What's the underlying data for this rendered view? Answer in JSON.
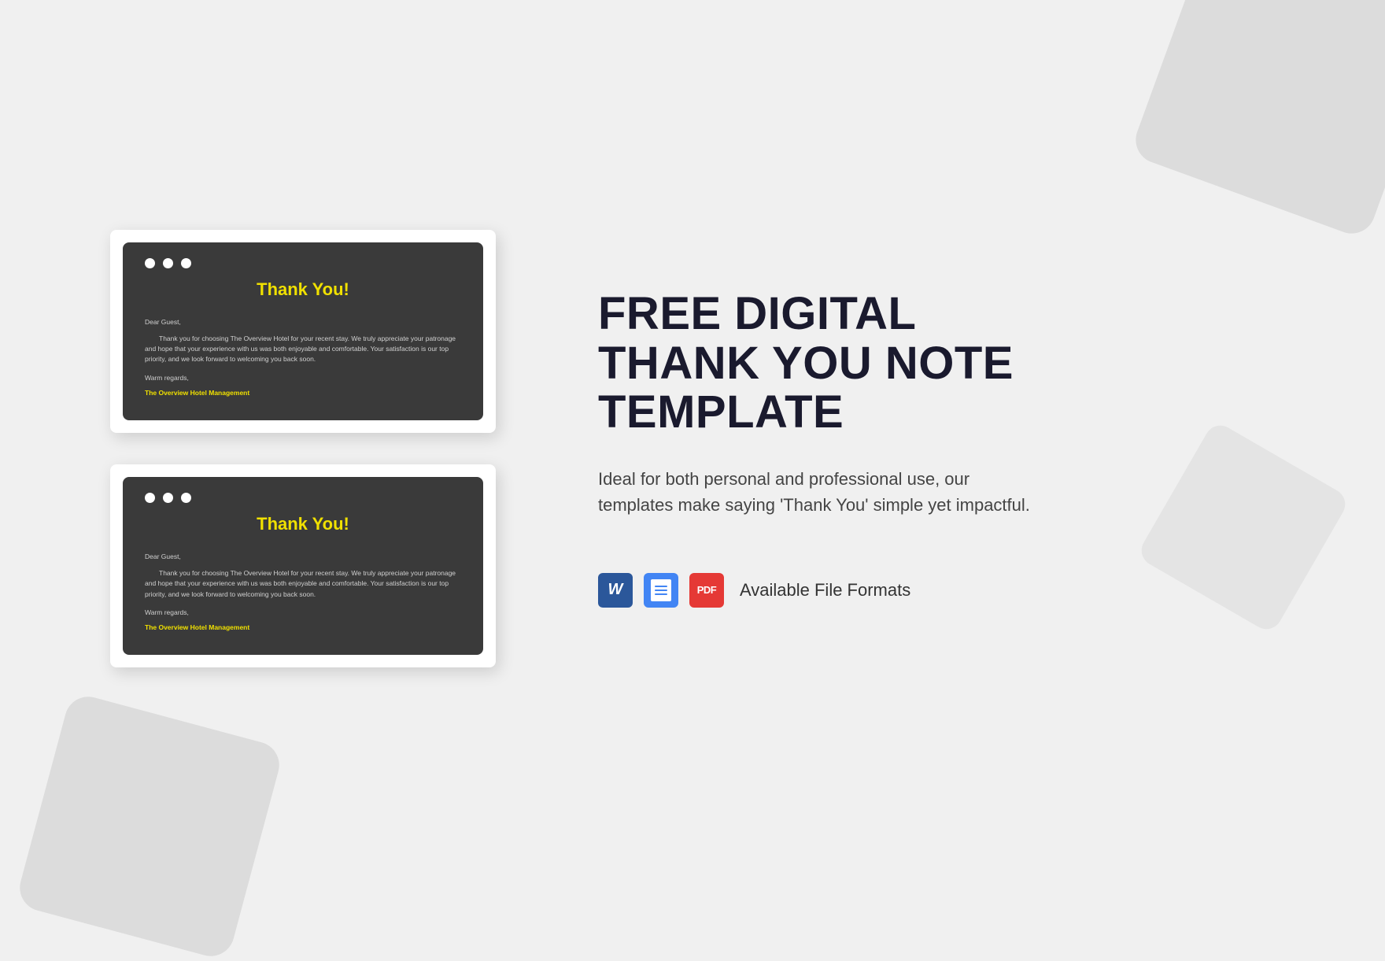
{
  "background": {
    "color": "#f0f0f0"
  },
  "card": {
    "dots": [
      "dot1",
      "dot2",
      "dot3"
    ],
    "title": "Thank You!",
    "title_color": "#f0e000",
    "greeting": "Dear Guest,",
    "body_text": "Thank you for choosing The Overview Hotel for your recent stay. We truly appreciate your patronage and hope that your experience with us was both enjoyable and comfortable. Your satisfaction is our top priority, and we look forward to welcoming you back soon.",
    "closing": "Warm regards,",
    "signature": "The Overview Hotel Management"
  },
  "right": {
    "main_title": "FREE DIGITAL\nTHANK YOU NOTE\nTEMPLATE",
    "description": "Ideal for both personal and professional use, our templates make saying 'Thank You' simple yet impactful.",
    "file_formats_label": "Available File Formats",
    "formats": [
      {
        "name": "Microsoft Word",
        "short": "W",
        "type": "word"
      },
      {
        "name": "Google Docs",
        "short": "docs",
        "type": "docs"
      },
      {
        "name": "PDF",
        "short": "PDF",
        "type": "pdf"
      }
    ]
  }
}
